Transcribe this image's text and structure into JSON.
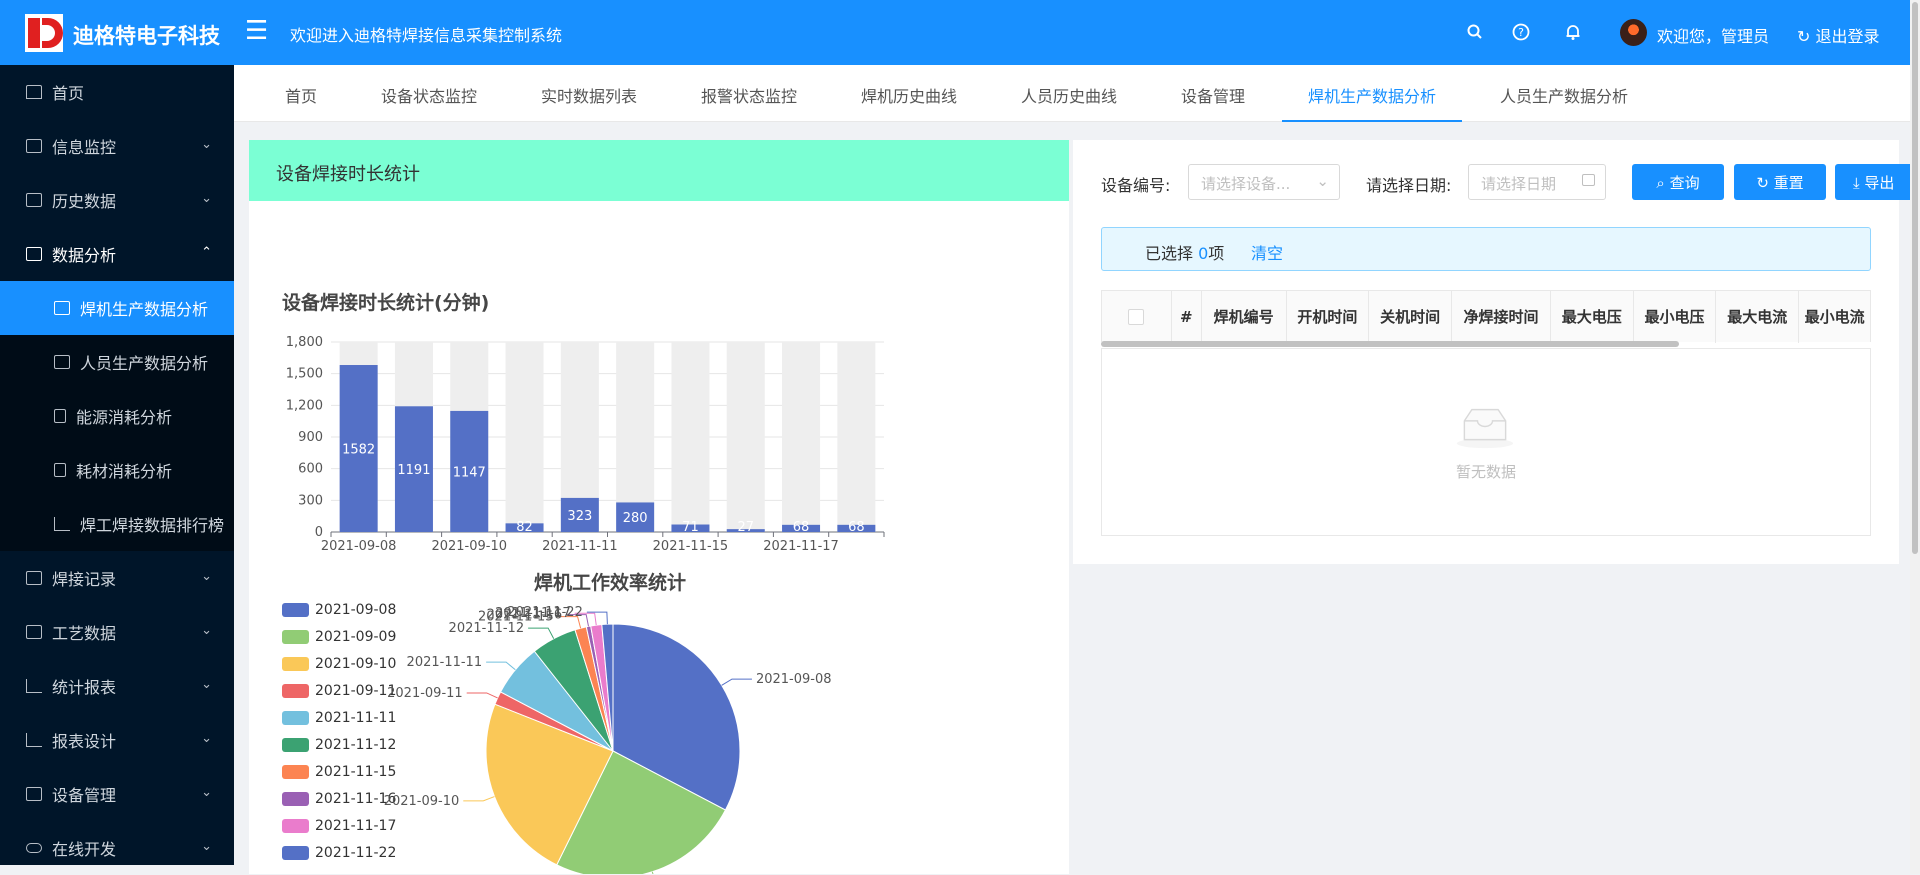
{
  "header": {
    "brand": "迪格特电子科技",
    "welcome": "欢迎进入迪格特焊接信息采集控制系统",
    "user_greeting": "欢迎您，管理员",
    "logout": "退出登录",
    "icons": [
      "search-icon",
      "help-icon",
      "bell-icon"
    ]
  },
  "sidebar": {
    "items": [
      {
        "label": "首页",
        "icon": "home-icon",
        "arrow": ""
      },
      {
        "label": "信息监控",
        "icon": "chart-icon",
        "arrow": "⌄"
      },
      {
        "label": "历史数据",
        "icon": "chart-icon",
        "arrow": "⌄"
      },
      {
        "label": "数据分析",
        "icon": "chart-icon",
        "arrow": "⌃"
      }
    ],
    "sub_items": [
      {
        "label": "焊机生产数据分析",
        "active": true
      },
      {
        "label": "人员生产数据分析"
      },
      {
        "label": "能源消耗分析"
      },
      {
        "label": "耗材消耗分析"
      },
      {
        "label": "焊工焊接数据排行榜"
      }
    ],
    "bottom_items": [
      {
        "label": "焊接记录",
        "arrow": "⌄"
      },
      {
        "label": "工艺数据",
        "arrow": "⌄"
      },
      {
        "label": "统计报表",
        "arrow": "⌄"
      },
      {
        "label": "报表设计",
        "arrow": "⌄"
      },
      {
        "label": "设备管理",
        "arrow": "⌄"
      },
      {
        "label": "在线开发",
        "arrow": "⌄"
      }
    ]
  },
  "tabs": [
    "首页",
    "设备状态监控",
    "实时数据列表",
    "报警状态监控",
    "焊机历史曲线",
    "人员历史曲线",
    "设备管理",
    "焊机生产数据分析",
    "人员生产数据分析"
  ],
  "active_tab": "焊机生产数据分析",
  "left_card": {
    "header": "设备焊接时长统计"
  },
  "bar_chart": {
    "title": "设备焊接时长统计(分钟)",
    "yticks": [
      "0",
      "300",
      "600",
      "900",
      "1,200",
      "1,500",
      "1,800"
    ],
    "xlabels": [
      "2021-09-08",
      "2021-09-10",
      "2021-11-11",
      "2021-11-15",
      "2021-11-17"
    ]
  },
  "pie_chart": {
    "title": "焊机工作效率统计"
  },
  "chart_data": [
    {
      "type": "bar",
      "title": "设备焊接时长统计(分钟)",
      "categories": [
        "2021-09-08",
        "2021-09-09",
        "2021-09-10",
        "2021-09-11",
        "2021-11-11",
        "2021-11-12",
        "2021-11-15",
        "2021-11-16",
        "2021-11-17",
        "2021-11-22"
      ],
      "values": [
        1582,
        1191,
        1147,
        82,
        323,
        280,
        71,
        27,
        68,
        68
      ],
      "ylim": [
        0,
        1800
      ],
      "color": "#5470c6",
      "background_bar_color": "#eeeeee"
    },
    {
      "type": "pie",
      "title": "焊机工作效率统计",
      "categories": [
        "2021-09-08",
        "2021-09-09",
        "2021-09-10",
        "2021-09-11",
        "2021-11-11",
        "2021-11-12",
        "2021-11-15",
        "2021-11-16",
        "2021-11-17",
        "2021-11-22"
      ],
      "values": [
        1582,
        1191,
        1147,
        82,
        323,
        280,
        71,
        27,
        68,
        68
      ],
      "colors": [
        "#5470c6",
        "#91cc75",
        "#fac858",
        "#ee6666",
        "#73c0de",
        "#3ba272",
        "#fc8452",
        "#9a60b4",
        "#ea7ccc",
        "#5470c6"
      ],
      "legend_position": "left"
    }
  ],
  "filters": {
    "device_label": "设备编号:",
    "device_placeholder": "请选择设备...",
    "date_label": "请选择日期:",
    "date_placeholder": "请选择日期",
    "query": "查询",
    "reset": "重置",
    "export": "导出"
  },
  "selection": {
    "prefix": "已选择 ",
    "count": "0",
    "suffix": "项",
    "clear": "清空"
  },
  "table": {
    "columns": [
      "#",
      "焊机编号",
      "开机时间",
      "关机时间",
      "净焊接时间",
      "最大电压",
      "最小电压",
      "最大电流",
      "最小电流"
    ],
    "empty": "暂无数据"
  }
}
